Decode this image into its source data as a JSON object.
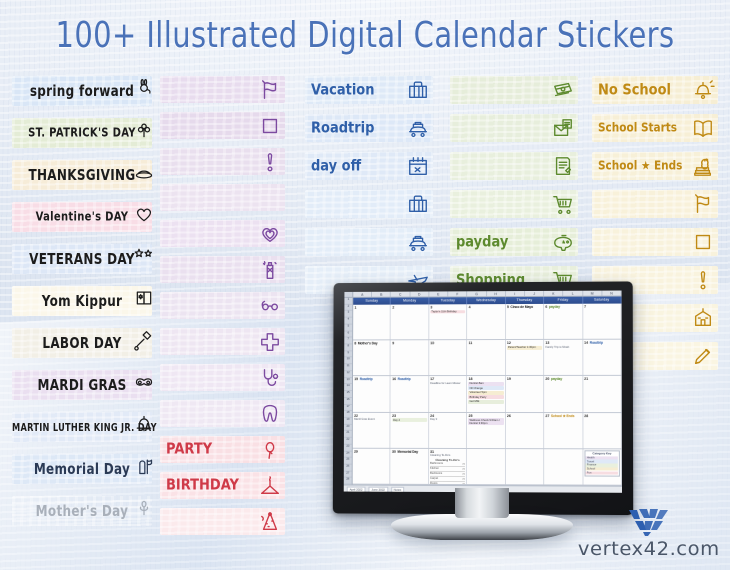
{
  "page": {
    "title": "100+ Illustrated Digital Calendar Stickers",
    "brand_name": "vertex42.com",
    "brand_mark": "vertex-chevron-logo"
  },
  "colors": {
    "title_blue": "#4a72b8",
    "holiday_ink": "#1c1c1c",
    "purple": "#7c4aa0",
    "blue": "#2f5fa8",
    "green": "#5d8a2e",
    "gold": "#c08a15",
    "red": "#cf3a48",
    "gray": "#9aa3ad"
  },
  "columns": [
    {
      "id": "holidays",
      "name": "holiday-word-art-column",
      "accent": "#1c1c1c",
      "stickers": [
        {
          "label": "spring forward",
          "icon": "bunny-icon",
          "wash": "#d9e6f6",
          "ink": "#1c1c1c"
        },
        {
          "label": "ST. PATRICK'S DAY",
          "icon": "clover-banner-icon",
          "wash": "#e4ecd6",
          "ink": "#1c1c1c"
        },
        {
          "label": "THANKSGIVING",
          "icon": "pie-slice-icon",
          "wash": "#f6ecd8",
          "ink": "#1c1c1c"
        },
        {
          "label": "Valentine's DAY",
          "icon": "xoxo-heart-icon",
          "wash": "#f8dde6",
          "ink": "#1c1c1c"
        },
        {
          "label": "VETERANS DAY",
          "icon": "stars-icon",
          "wash": "#dde7f6",
          "ink": "#1c1c1c"
        },
        {
          "label": "Yom Kippur",
          "icon": "star-of-david-book-icon",
          "wash": "#fbf7ea",
          "ink": "#1c1c1c"
        },
        {
          "label": "LABOR DAY",
          "icon": "tools-icon",
          "wash": "#f2efe6",
          "ink": "#1c1c1c"
        },
        {
          "label": "MARDI GRAS",
          "icon": "mask-icon",
          "wash": "#eadff0",
          "ink": "#1c1c1c"
        },
        {
          "label": "MARTIN LUTHER KING JR. DAY",
          "icon": "freedom-bell-icon",
          "wash": "#e2eaf7",
          "ink": "#1c1c1c"
        },
        {
          "label": "Memorial Day",
          "icon": "headstone-flag-icon",
          "wash": "#dde8f6",
          "ink": "#2b3a55"
        },
        {
          "label": "Mother's Day",
          "icon": "flower-flourish-icon",
          "wash": "#ffffff",
          "ink": "#a9b0ba"
        }
      ]
    },
    {
      "id": "purple-blanks",
      "name": "purple-blank-label-column",
      "accent": "#7c4aa0",
      "stickers": [
        {
          "label": "",
          "icon": "flag-icon",
          "wash": "#e8dcee",
          "ink": "#7c4aa0"
        },
        {
          "label": "",
          "icon": "square-checkbox-icon",
          "wash": "#e6daec",
          "ink": "#7c4aa0"
        },
        {
          "label": "",
          "icon": "exclamation-icon",
          "wash": "#e9dfee",
          "ink": "#7c4aa0"
        },
        {
          "label": "",
          "icon": "blank-icon",
          "wash": "#ece3f0",
          "ink": "#7c4aa0"
        },
        {
          "label": "",
          "icon": "heart-icon",
          "wash": "#ece1f1",
          "ink": "#7c4aa0"
        },
        {
          "label": "",
          "icon": "spray-bottle-icon",
          "wash": "#eae0ef",
          "ink": "#7c4aa0"
        },
        {
          "label": "",
          "icon": "eyeglasses-icon",
          "wash": "#ece4f1",
          "ink": "#7c4aa0"
        },
        {
          "label": "",
          "icon": "medical-cross-icon",
          "wash": "#eee6f2",
          "ink": "#7c4aa0"
        },
        {
          "label": "",
          "icon": "stethoscope-icon",
          "wash": "#efe7f3",
          "ink": "#7c4aa0"
        },
        {
          "label": "",
          "icon": "tooth-icon",
          "wash": "#efe8f3",
          "ink": "#7c4aa0"
        },
        {
          "label": "PARTY",
          "icon": "balloons-icon",
          "wash": "#f9e0e4",
          "ink": "#cf3a48"
        },
        {
          "label": "BIRTHDAY",
          "icon": "cake-slice-icon",
          "wash": "#fae2e6",
          "ink": "#cf3a48"
        },
        {
          "label": "",
          "icon": "party-hat-icon",
          "wash": "#fbeaec",
          "ink": "#cf3a48"
        }
      ]
    },
    {
      "id": "travel",
      "name": "blue-travel-column",
      "accent": "#2f5fa8",
      "stickers": [
        {
          "label": "Vacation",
          "icon": "suitcase-icon",
          "wash": "#dee9f7",
          "ink": "#2f5fa8"
        },
        {
          "label": "Roadtrip",
          "icon": "loaded-car-icon",
          "wash": "#dde8f7",
          "ink": "#2f5fa8"
        },
        {
          "label": "day off",
          "icon": "calendar-x-icon",
          "wash": "#dfe9f7",
          "ink": "#2f5fa8"
        },
        {
          "label": "",
          "icon": "suitcase-icon",
          "wash": "#e2ecf8",
          "ink": "#2f5fa8"
        },
        {
          "label": "",
          "icon": "loaded-car-icon",
          "wash": "#e3edf8",
          "ink": "#2f5fa8"
        },
        {
          "label": "",
          "icon": "airplane-icon",
          "wash": "#e5eef8",
          "ink": "#2f5fa8"
        }
      ]
    },
    {
      "id": "money",
      "name": "green-finance-column",
      "accent": "#5d8a2e",
      "stickers": [
        {
          "label": "",
          "icon": "cash-stack-icon",
          "wash": "#e6edda",
          "ink": "#5d8a2e"
        },
        {
          "label": "",
          "icon": "bill-envelope-icon",
          "wash": "#e7eedc",
          "ink": "#5d8a2e"
        },
        {
          "label": "",
          "icon": "tax-form-icon",
          "wash": "#e8efdd",
          "ink": "#5d8a2e"
        },
        {
          "label": "",
          "icon": "shopping-cart-icon",
          "wash": "#e9f0de",
          "ink": "#5d8a2e"
        },
        {
          "label": "payday",
          "icon": "piggy-bank-icon",
          "wash": "#e6eed9",
          "ink": "#5d8a2e"
        },
        {
          "label": "Shopping",
          "icon": "shopping-cart-icon",
          "wash": "#e8efdc",
          "ink": "#5d8a2e"
        }
      ]
    },
    {
      "id": "school",
      "name": "gold-school-column",
      "accent": "#c08a15",
      "stickers": [
        {
          "label": "No School",
          "icon": "school-bell-icon",
          "wash": "#f6eed4",
          "ink": "#c08a15"
        },
        {
          "label": "School Starts",
          "icon": "open-book-icon",
          "wash": "#f7efd6",
          "ink": "#c08a15"
        },
        {
          "label": "School ★ Ends",
          "icon": "apple-books-icon",
          "wash": "#f7f0d8",
          "ink": "#c08a15"
        },
        {
          "label": "",
          "icon": "flag-icon",
          "wash": "#f8f1da",
          "ink": "#c08a15"
        },
        {
          "label": "",
          "icon": "square-checkbox-icon",
          "wash": "#f8f2dc",
          "ink": "#c08a15"
        },
        {
          "label": "",
          "icon": "exclamation-icon",
          "wash": "#f9f3de",
          "ink": "#c08a15"
        },
        {
          "label": "",
          "icon": "schoolhouse-icon",
          "wash": "#f9f4e0",
          "ink": "#c08a15"
        },
        {
          "label": "",
          "icon": "pencil-icon",
          "wash": "#faf5e2",
          "ink": "#c08a15"
        }
      ]
    }
  ],
  "calendar": {
    "app": "spreadsheet-calendar",
    "column_letters": [
      "A",
      "B",
      "C",
      "D",
      "E",
      "F",
      "G",
      "H",
      "I",
      "J",
      "K",
      "L",
      "M",
      "N"
    ],
    "row_numbers": [
      "1",
      "2",
      "3",
      "4",
      "5",
      "6",
      "7",
      "8",
      "9",
      "10",
      "11",
      "12",
      "13",
      "14",
      "15",
      "16",
      "17",
      "18",
      "19",
      "20",
      "21",
      "22",
      "23",
      "24",
      "25",
      "26",
      "27",
      "28"
    ],
    "weekday_headers": [
      "Sunday",
      "Monday",
      "Tuesday",
      "Wednesday",
      "Thursday",
      "Friday",
      "Saturday"
    ],
    "sheet_tabs": [
      "April 2022",
      "June 2022",
      "Notes"
    ],
    "weeks": [
      [
        {
          "num": "1",
          "events": []
        },
        {
          "num": "2",
          "events": []
        },
        {
          "num": "3",
          "events": [
            {
              "text": "Taylor's 11th Birthday",
              "type": "box",
              "color": "#f7dde1"
            }
          ]
        },
        {
          "num": "4",
          "events": []
        },
        {
          "num": "5",
          "sticker": {
            "text": "Cinco de Mayo",
            "color": "black"
          },
          "events": []
        },
        {
          "num": "6",
          "sticker": {
            "text": "payday",
            "color": "green"
          },
          "events": []
        },
        {
          "num": "7",
          "events": []
        }
      ],
      [
        {
          "num": "8",
          "sticker": {
            "text": "Mother's Day",
            "color": "black"
          },
          "events": []
        },
        {
          "num": "9",
          "events": []
        },
        {
          "num": "10",
          "events": []
        },
        {
          "num": "11",
          "events": []
        },
        {
          "num": "12",
          "events": [
            {
              "text": "Parent/Teacher 1:30pm",
              "type": "box",
              "color": "#f6edd2"
            }
          ]
        },
        {
          "num": "13",
          "events": [
            {
              "text": "Family Trip to Moab",
              "type": "plain",
              "color": "#dfe9f7"
            }
          ]
        },
        {
          "num": "14",
          "sticker": {
            "text": "Roadtrip",
            "color": "blue"
          },
          "events": []
        }
      ],
      [
        {
          "num": "15",
          "sticker": {
            "text": "Roadtrip",
            "color": "blue"
          },
          "events": []
        },
        {
          "num": "16",
          "sticker": {
            "text": "Roadtrip",
            "color": "blue"
          },
          "events": []
        },
        {
          "num": "17",
          "events": [
            {
              "text": "Deadline for Lawn Mower",
              "type": "plain",
              "color": "#f7dde1"
            }
          ]
        },
        {
          "num": "18",
          "events": [
            {
              "text": "Dentist 8am",
              "type": "box",
              "color": "#ece1f1"
            },
            {
              "text": "Oil Change",
              "type": "box",
              "color": "#dfe9f7"
            },
            {
              "text": "Volunteer 5pm",
              "type": "box",
              "color": "#f6edd2"
            },
            {
              "text": "Birthday Party",
              "type": "box",
              "color": "#f7dde1"
            },
            {
              "text": "Get Milk",
              "type": "box",
              "color": "#e7eedc"
            }
          ]
        },
        {
          "num": "19",
          "events": []
        },
        {
          "num": "20",
          "sticker": {
            "text": "payday",
            "color": "green"
          },
          "events": []
        },
        {
          "num": "21",
          "events": []
        }
      ],
      [
        {
          "num": "22",
          "events": [
            {
              "text": "Mardi Gras Event",
              "type": "plain",
              "color": "#eadff0"
            }
          ]
        },
        {
          "num": "23",
          "events": [
            {
              "text": "Day 2",
              "type": "box",
              "color": "#e9f0de"
            }
          ]
        },
        {
          "num": "24",
          "events": [
            {
              "text": "Day 3",
              "type": "plain",
              "color": "#e9f0de"
            }
          ]
        },
        {
          "num": "25",
          "events": [
            {
              "text": "Wellness Check 9:00am / Dentist 3:30pm",
              "type": "box",
              "color": "#ece1f1"
            }
          ]
        },
        {
          "num": "26",
          "events": []
        },
        {
          "num": "27",
          "sticker": {
            "text": "School ★ Ends",
            "color": "gold"
          },
          "events": []
        },
        {
          "num": "28",
          "events": []
        }
      ],
      [
        {
          "num": "29",
          "events": []
        },
        {
          "num": "30",
          "sticker": {
            "text": "Memorial Day",
            "color": "black"
          },
          "events": []
        },
        {
          "num": "31",
          "events": [
            {
              "text": "Cleaning To-Do's",
              "type": "plain",
              "color": "#f2f2f2"
            }
          ]
        },
        {
          "num": "",
          "events": []
        },
        {
          "num": "",
          "events": []
        },
        {
          "num": "",
          "events": []
        },
        {
          "num": "",
          "events": []
        }
      ]
    ],
    "todo_title": "Cleaning To-Do's",
    "todo_items": [
      "Bathrooms",
      "Kitchen",
      "Bedrooms",
      "Carpet",
      "Floors"
    ],
    "category_key": {
      "title": "Category Key",
      "rows": [
        {
          "label": "Health",
          "color": "#ece1f1"
        },
        {
          "label": "Travel",
          "color": "#dfe9f7"
        },
        {
          "label": "Finance",
          "color": "#e9f0de"
        },
        {
          "label": "School",
          "color": "#f6edd2"
        },
        {
          "label": "Fun",
          "color": "#f7dde1"
        }
      ]
    }
  }
}
